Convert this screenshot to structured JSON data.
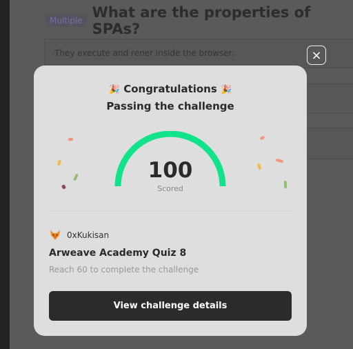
{
  "question": {
    "badge": "Multiple",
    "title": "What are the properties of SPAs?",
    "answers": [
      "They execute and rener inside the browser.",
      "",
      "",
      ""
    ]
  },
  "modal": {
    "close_icon": "×",
    "party_icon": "🎉",
    "title": "Congratulations",
    "subtitle": "Passing the challenge",
    "score": "100",
    "score_label": "Scored",
    "score_fraction": 1.0,
    "user": {
      "name": "0xKukisan",
      "avatar_icon": "fox-icon"
    },
    "quiz_title": "Arweave Academy Quiz 8",
    "quiz_description": "Reach 60 to complete the challenge",
    "cta_label": "View challenge details",
    "colors": {
      "gauge": "#12e28a",
      "card": "#dedede",
      "button": "#2b2b2b"
    }
  }
}
